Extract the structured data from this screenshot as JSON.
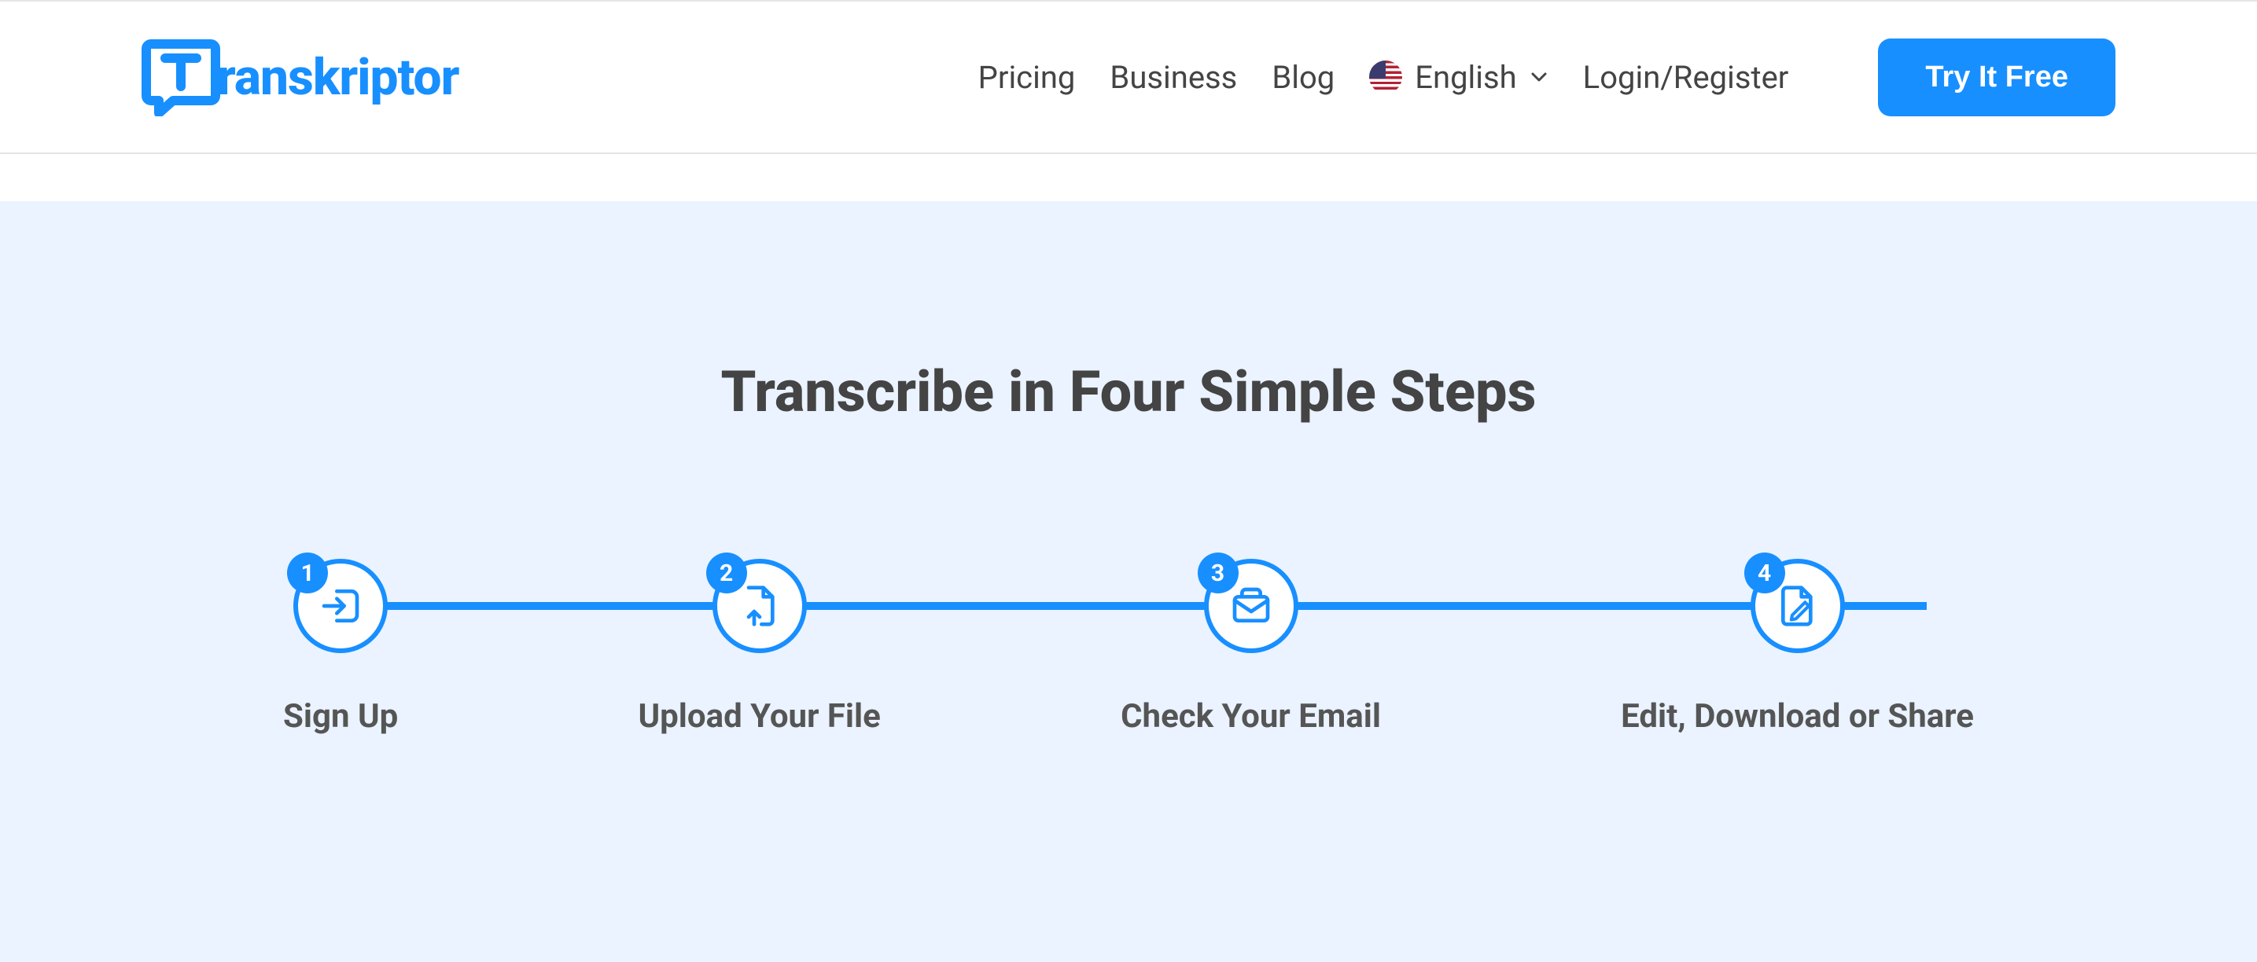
{
  "brand": {
    "name": "Transkriptor",
    "text_part": "ranskriptor"
  },
  "nav": {
    "pricing": "Pricing",
    "business": "Business",
    "blog": "Blog",
    "language_label": "English",
    "login": "Login/Register",
    "cta": "Try It Free"
  },
  "section": {
    "heading": "Transcribe in Four Simple Steps"
  },
  "steps": [
    {
      "n": "1",
      "label": "Sign Up",
      "icon": "login-icon"
    },
    {
      "n": "2",
      "label": "Upload Your File",
      "icon": "upload-file-icon"
    },
    {
      "n": "3",
      "label": "Check Your Email",
      "icon": "mail-icon"
    },
    {
      "n": "4",
      "label": "Edit, Download or Share",
      "icon": "edit-file-icon"
    }
  ],
  "colors": {
    "accent": "#188fff",
    "text": "#444444",
    "section_bg": "#eaf3ff"
  }
}
